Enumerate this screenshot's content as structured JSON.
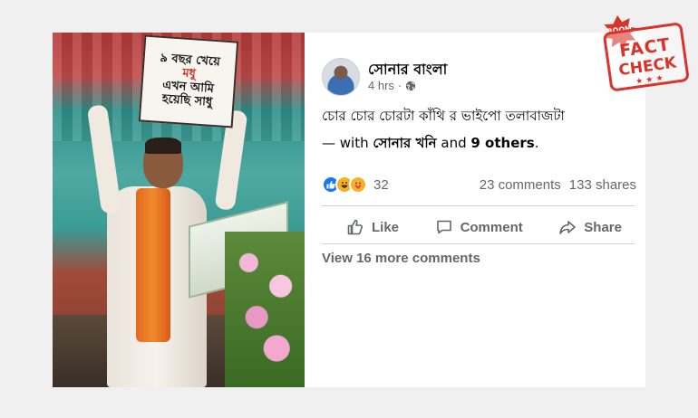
{
  "image": {
    "placard_lines": [
      "৯ বছর খেয়ে",
      "মধু",
      "এখন আমি",
      "হয়েছি সাধু"
    ]
  },
  "post": {
    "author": "সোনার বাংলা",
    "time": "4 hrs",
    "privacy_icon": "globe-icon",
    "text_line1": "চোর চোর চোরটা কাঁথি র ভাইপো তলাবাজটা",
    "with_prefix": "— with",
    "tagged_name": "সোনার খনি",
    "tagged_and": "and",
    "tagged_others": "9 others",
    "tagged_suffix": ".",
    "reaction_count": "32",
    "comments": "23 comments",
    "shares": "133 shares",
    "actions": {
      "like": "Like",
      "comment": "Comment",
      "share": "Share"
    },
    "more_comments": "View 16 more comments"
  },
  "stamp": {
    "brand": "BOOM",
    "line1": "FACT",
    "line2": "CHECK",
    "color": "#d9342b"
  },
  "colors": {
    "like_blue": "#1877f2",
    "text_secondary": "#65676b"
  }
}
